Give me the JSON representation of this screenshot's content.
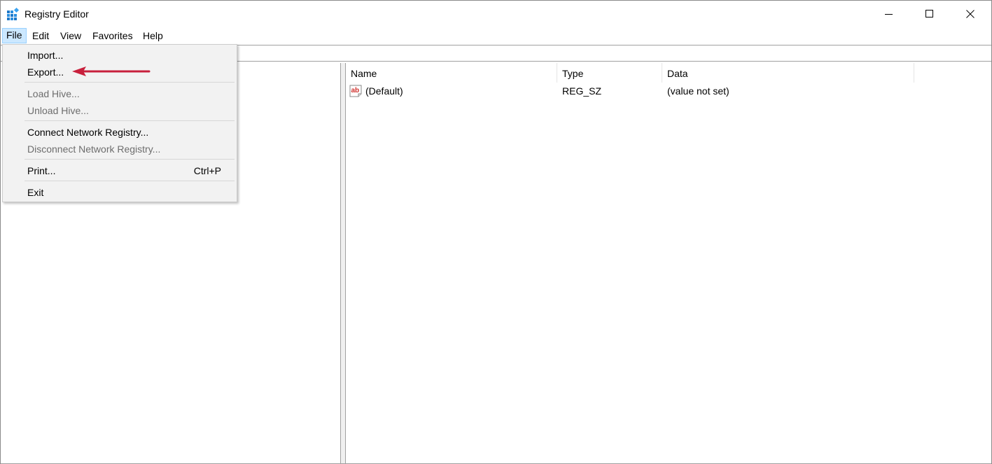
{
  "window": {
    "title": "Registry Editor"
  },
  "menubar": {
    "items": [
      {
        "label": "File"
      },
      {
        "label": "Edit"
      },
      {
        "label": "View"
      },
      {
        "label": "Favorites"
      },
      {
        "label": "Help"
      }
    ]
  },
  "file_menu": {
    "items": [
      {
        "label": "Import...",
        "enabled": true
      },
      {
        "label": "Export...",
        "enabled": true
      },
      {
        "label": "Load Hive...",
        "enabled": false
      },
      {
        "label": "Unload Hive...",
        "enabled": false
      },
      {
        "label": "Connect Network Registry...",
        "enabled": true
      },
      {
        "label": "Disconnect Network Registry...",
        "enabled": false
      },
      {
        "label": "Print...",
        "shortcut": "Ctrl+P",
        "enabled": true
      },
      {
        "label": "Exit",
        "enabled": true
      }
    ]
  },
  "list": {
    "columns": [
      {
        "label": "Name"
      },
      {
        "label": "Type"
      },
      {
        "label": "Data"
      }
    ],
    "rows": [
      {
        "name": "(Default)",
        "type": "REG_SZ",
        "data": "(value not set)",
        "icon": "string-value-icon"
      }
    ]
  },
  "colors": {
    "menu_highlight": "#cce8ff",
    "menu_highlight_border": "#99d1ff",
    "annotation_arrow": "#c8203c",
    "disabled_text": "#6d6d6d"
  }
}
